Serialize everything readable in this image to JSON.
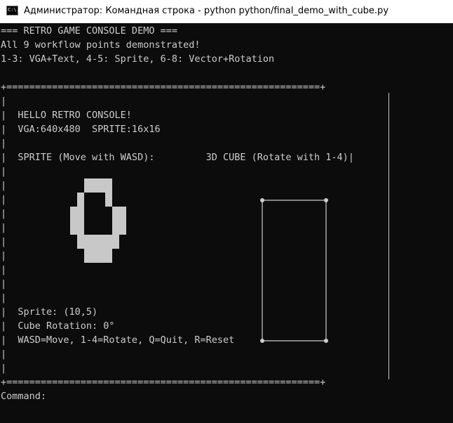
{
  "window": {
    "title": "Администратор: Командная строка - python  python/final_demo_with_cube.py",
    "icon": "cmd-icon",
    "icon_text": "C:\\."
  },
  "console": {
    "lines": [
      "=== RETRO GAME CONSOLE DEMO ===",
      "All 9 workflow points demonstrated!",
      "1-3: VGA+Text, 4-5: Sprite, 6-8: Vector+Rotation",
      "",
      "+=======================================================+",
      "|",
      "|  HELLO RETRO CONSOLE!",
      "|  VGA:640x480  SPRITE:16x16",
      "|",
      "|  SPRITE (Move with WASD):         3D CUBE (Rotate with 1-4)|",
      "|",
      "|",
      "|",
      "|",
      "|",
      "|",
      "|",
      "|",
      "|",
      "|",
      "|  Sprite: (10,5)",
      "|  Cube Rotation: 0°",
      "|  WASD=Move, 1-4=Rotate, Q=Quit, R=Reset",
      "|",
      "|",
      "+=======================================================+",
      "Command:"
    ]
  },
  "colors": {
    "text": "#cccccc",
    "background": "#0c0c0c",
    "sprite": "#c8c8c8",
    "cube": "#cccccc",
    "titlebar": "#ffffff"
  }
}
